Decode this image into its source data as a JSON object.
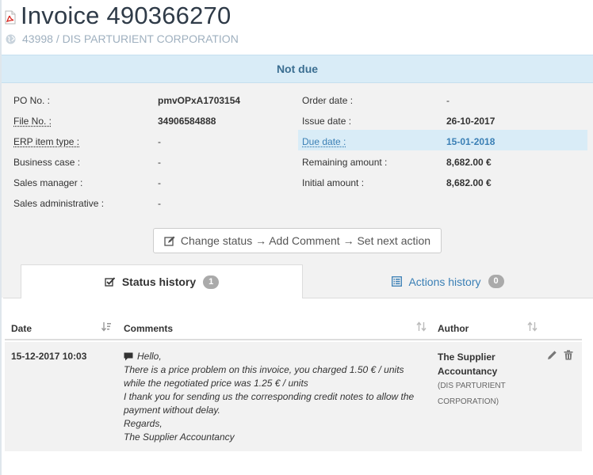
{
  "header": {
    "title_prefix": "Invoice",
    "invoice_number": "490366270",
    "subtitle": "43998 / DIS PARTURIENT CORPORATION"
  },
  "status_banner": "Not due",
  "info_left": [
    {
      "label": "PO No. :",
      "value": "pmvOPxA1703154",
      "underline": false
    },
    {
      "label": "File No. :",
      "value": "34906584888",
      "underline": true
    },
    {
      "label": "ERP item type :",
      "value": "-",
      "underline": true
    },
    {
      "label": "Business case :",
      "value": "-",
      "underline": false
    },
    {
      "label": "Sales manager :",
      "value": "-",
      "underline": false
    },
    {
      "label": "Sales administrative :",
      "value": "-",
      "underline": false
    }
  ],
  "info_right": [
    {
      "label": "Order date :",
      "value": "-"
    },
    {
      "label": "Issue date :",
      "value": "26-10-2017"
    },
    {
      "label": "Due date :",
      "value": "15-01-2018"
    },
    {
      "label": "Remaining amount :",
      "value": "8,682.00 €"
    },
    {
      "label": "Initial amount :",
      "value": "8,682.00 €"
    }
  ],
  "change_status_label": "Change status → Add Comment → Set next action",
  "tabs": [
    {
      "label": "Status history",
      "count": "1",
      "active": true
    },
    {
      "label": "Actions history",
      "count": "0",
      "active": false
    }
  ],
  "table": {
    "headers": {
      "date": "Date",
      "comments": "Comments",
      "author": "Author"
    },
    "rows": [
      {
        "date": "15-12-2017 10:03",
        "comment_lines": [
          "Hello,",
          "There is a price problem on this invoice, you charged 1.50 € / units",
          "while the negotiated price was 1.25 € / units",
          "I thank you for sending us the corresponding credit notes to allow the",
          "payment without delay.",
          "Regards,",
          "The Supplier Accountancy"
        ],
        "author_name_line1": "The Supplier",
        "author_name_line2": "Accountancy",
        "author_org_line1": "(DIS PARTURIENT",
        "author_org_line2": "CORPORATION)"
      }
    ]
  },
  "colors": {
    "banner_bg": "#d9ecf7",
    "link": "#3a7fb5",
    "panel_bg": "#f2f2f2",
    "badge": "#aaaaaa"
  }
}
